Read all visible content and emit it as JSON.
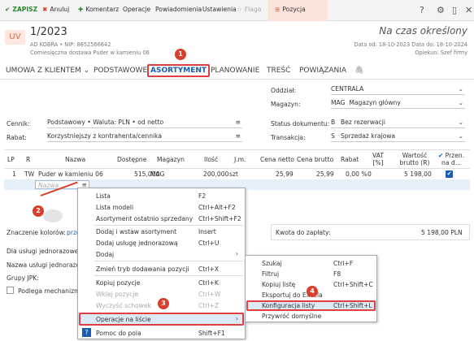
{
  "toolbar": {
    "save": "ZAPISZ",
    "cancel": "Anuluj",
    "comment": "Komentarz",
    "operations": "Operacje",
    "notifications": "Powiadomienia",
    "settings": "Ustawienia",
    "flag": "Flaga",
    "position": "Pozycja"
  },
  "header": {
    "badge": "UV",
    "doc_number": "1/2023",
    "company": "AD KOBRA • NIP: 8652566642",
    "description": "Comiesięczna dostawa Puder w kamieniu 06",
    "status": "Na czas określony",
    "dates": "Data od: 18-10-2023 Data do: 18-10-2024",
    "guardian": "Opiekun: Szef firmy"
  },
  "tabs": [
    "UMOWA Z KLIENTEM",
    "PODSTAWOWE",
    "ASORTYMENT",
    "PLANOWANIE",
    "TREŚĆ",
    "POWIĄZANIA"
  ],
  "form": {
    "oddzial_label": "Oddział:",
    "oddzial_value": "CENTRALA",
    "magazyn_label": "Magazyn:",
    "magazyn_code": "MAG",
    "magazyn_value": "Magazyn główny",
    "cennik_label": "Cennik:",
    "cennik_value": "Podstawowy • Waluta: PLN • od netto",
    "rabat_label": "Rabat:",
    "rabat_value": "Korzystniejszy z kontrahenta/cennika",
    "status_label": "Status dokumentu:",
    "status_code": "B",
    "status_value": "Bez rezerwacji",
    "transakcja_label": "Transakcja:",
    "transakcja_code": "S",
    "transakcja_value": "Sprzedaż krajowa"
  },
  "grid": {
    "headers": [
      "LP",
      "R",
      "Nazwa",
      "Dostępne",
      "Magazyn",
      "Ilość",
      "J.m.",
      "Cena netto",
      "Cena brutto",
      "Rabat",
      "VAT [%]",
      "Wartość brutto (R)",
      "Przen. na d..."
    ],
    "row": {
      "lp": "1",
      "r": "TW",
      "name": "Puder w kamieniu 06",
      "available": "515,000",
      "warehouse": "MAG",
      "qty": "200,000",
      "unit": "szt",
      "net": "25,99",
      "gross": "25,99",
      "discount": "0,00 %",
      "vat": "0",
      "value": "5 198,00"
    },
    "new_placeholder": "Nazwa"
  },
  "footer": {
    "colors_label": "Znaczenie kolorów:",
    "colors_value": "prze",
    "amount_label": "Kwota do zapłaty:",
    "amount_value": "5 198,00 PLN",
    "one_time": "Dla usługi jednorazowej na",
    "one_time_name": "Nazwa usługi jednorazowej",
    "jpk": "Grupy JPK:",
    "mechanism": "Podlega mechanizmo"
  },
  "context_menu": {
    "items": [
      {
        "label": "Lista",
        "shortcut": "F2"
      },
      {
        "label": "Lista modeli",
        "shortcut": "Ctrl+Alt+F2"
      },
      {
        "label": "Asortyment ostatnio sprzedany",
        "shortcut": "Ctrl+Shift+F2"
      },
      {
        "label": "Dodaj i wstaw asortyment",
        "shortcut": "Insert"
      },
      {
        "label": "Dodaj usługę jednorazową",
        "shortcut": "Ctrl+U"
      },
      {
        "label": "Dodaj",
        "shortcut": ""
      },
      {
        "label": "Zmień tryb dodawania pozycji",
        "shortcut": "Ctrl+X"
      },
      {
        "label": "Kopiuj pozycje",
        "shortcut": "Ctrl+K"
      },
      {
        "label": "Wklej pozycje",
        "shortcut": "Ctrl+W"
      },
      {
        "label": "Wyczyść schowek",
        "shortcut": "Ctrl+Z"
      },
      {
        "label": "Operacje na liście",
        "shortcut": ""
      },
      {
        "label": "Pomoc do pola",
        "shortcut": "Shift+F1"
      }
    ]
  },
  "submenu": {
    "items": [
      {
        "label": "Szukaj",
        "shortcut": "Ctrl+F"
      },
      {
        "label": "Filtruj",
        "shortcut": "F8"
      },
      {
        "label": "Kopiuj listę",
        "shortcut": "Ctrl+Shift+C"
      },
      {
        "label": "Eksportuj do Excela",
        "shortcut": ""
      },
      {
        "label": "Konfiguracja listy",
        "shortcut": "Ctrl+Shift+L"
      },
      {
        "label": "Przywróć domyślne",
        "shortcut": ""
      }
    ]
  },
  "badges": [
    "1",
    "2",
    "3",
    "4"
  ],
  "colors": {
    "accent": "#1a5db0",
    "highlight_red": "#e04040",
    "badge": "#d93f2c"
  }
}
